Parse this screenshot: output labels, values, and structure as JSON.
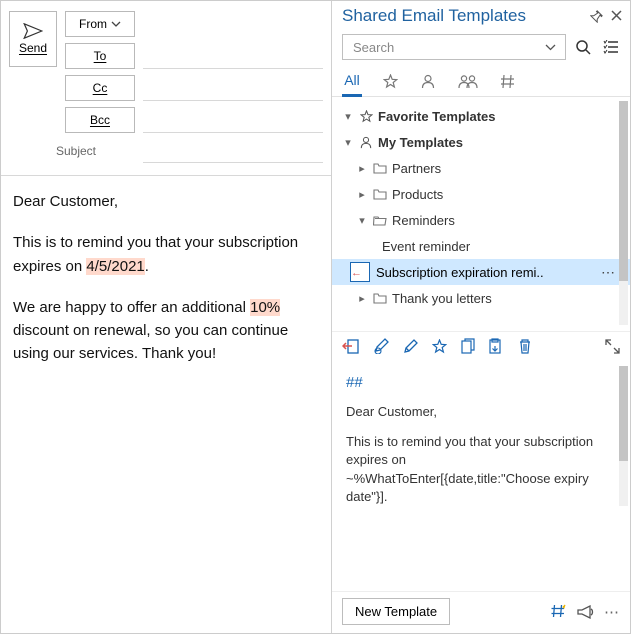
{
  "compose": {
    "send_label": "Send",
    "from_label": "From",
    "to_label": "To",
    "cc_label": "Cc",
    "bcc_label": "Bcc",
    "subject_label": "Subject",
    "to_value": "",
    "cc_value": "",
    "bcc_value": "",
    "subject_value": "",
    "body_p1": "Dear Customer,",
    "body_p2a": "This is to remind you that your subscription expires on ",
    "body_date": "4/5/2021",
    "body_p2b": ".",
    "body_p3a": "We are happy to offer an additional ",
    "body_pct": "10%",
    "body_p3b": " discount on renewal, so you can continue using our services. Thank you!"
  },
  "panel": {
    "title": "Shared Email Templates",
    "search_placeholder": "Search",
    "tabs": {
      "all": "All"
    },
    "tree": {
      "favorite": "Favorite Templates",
      "my": "My Templates",
      "partners": "Partners",
      "products": "Products",
      "reminders": "Reminders",
      "event_reminder": "Event reminder",
      "sub_reminder": "Subscription expiration remi..",
      "thank_you": "Thank you letters"
    },
    "preview": {
      "hashes": "##",
      "p1": "Dear Customer,",
      "p2": "This is to remind you that your subscription expires on ~%WhatToEnter[{date,title:\"Choose expiry date\"}]."
    },
    "new_template": "New Template"
  }
}
